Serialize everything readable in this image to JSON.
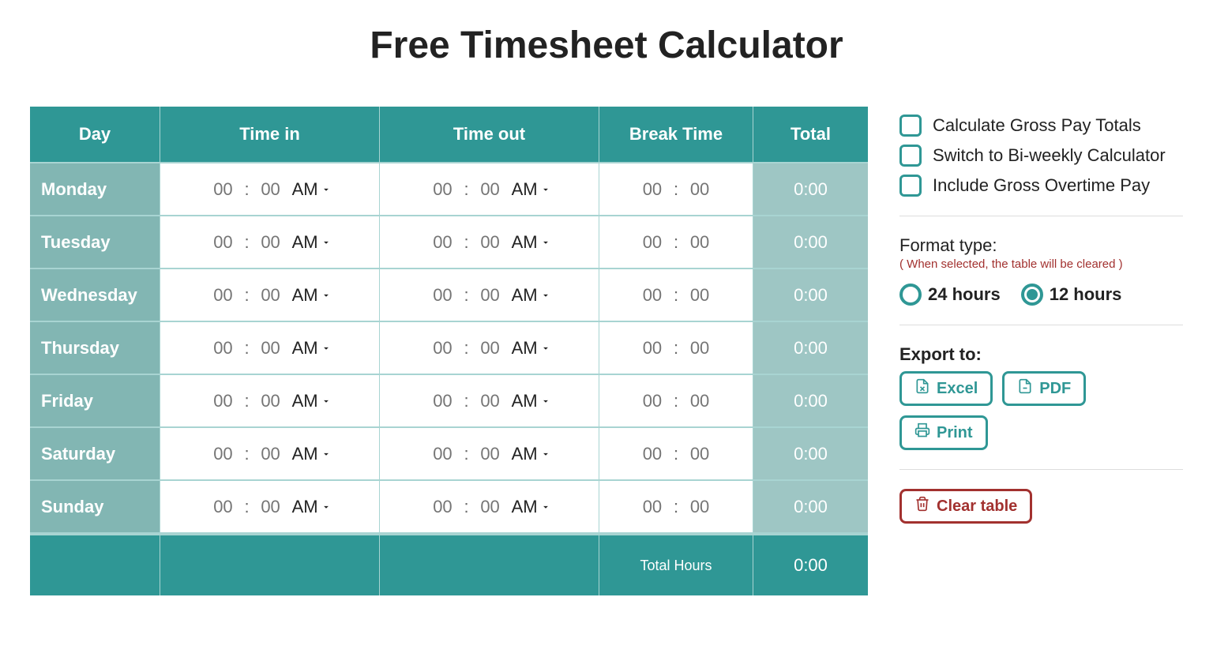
{
  "title": "Free Timesheet Calculator",
  "columns": {
    "day": "Day",
    "time_in": "Time in",
    "time_out": "Time out",
    "break": "Break Time",
    "total": "Total"
  },
  "ampm_default": "AM",
  "placeholders": {
    "hh": "00",
    "mm": "00"
  },
  "rows": [
    {
      "day": "Monday",
      "in_h": "",
      "in_m": "",
      "out_h": "",
      "out_m": "",
      "br_h": "",
      "br_m": "",
      "total": "0:00"
    },
    {
      "day": "Tuesday",
      "in_h": "",
      "in_m": "",
      "out_h": "",
      "out_m": "",
      "br_h": "",
      "br_m": "",
      "total": "0:00"
    },
    {
      "day": "Wednesday",
      "in_h": "",
      "in_m": "",
      "out_h": "",
      "out_m": "",
      "br_h": "",
      "br_m": "",
      "total": "0:00"
    },
    {
      "day": "Thursday",
      "in_h": "",
      "in_m": "",
      "out_h": "",
      "out_m": "",
      "br_h": "",
      "br_m": "",
      "total": "0:00"
    },
    {
      "day": "Friday",
      "in_h": "",
      "in_m": "",
      "out_h": "",
      "out_m": "",
      "br_h": "",
      "br_m": "",
      "total": "0:00"
    },
    {
      "day": "Saturday",
      "in_h": "",
      "in_m": "",
      "out_h": "",
      "out_m": "",
      "br_h": "",
      "br_m": "",
      "total": "0:00"
    },
    {
      "day": "Sunday",
      "in_h": "",
      "in_m": "",
      "out_h": "",
      "out_m": "",
      "br_h": "",
      "br_m": "",
      "total": "0:00"
    }
  ],
  "footer": {
    "label": "Total Hours",
    "total": "0:00"
  },
  "options": {
    "gross_pay": "Calculate Gross Pay Totals",
    "biweekly": "Switch to Bi-weekly Calculator",
    "overtime": "Include Gross Overtime Pay"
  },
  "format": {
    "title": "Format type:",
    "note": "( When selected, the table will be cleared )",
    "opt24": "24 hours",
    "opt12": "12 hours",
    "selected": "12"
  },
  "export": {
    "title": "Export to:",
    "excel": "Excel",
    "pdf": "PDF",
    "print": "Print"
  },
  "clear": "Clear table"
}
